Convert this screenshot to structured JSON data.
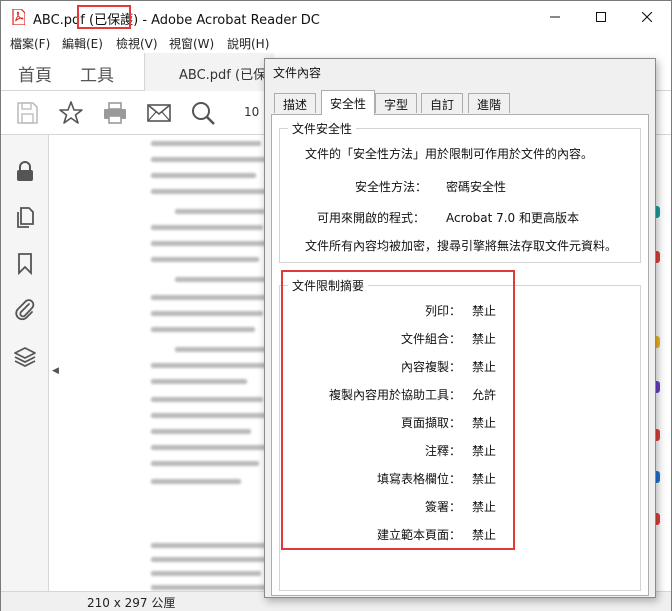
{
  "window": {
    "title_prefix": "ABC.pdf",
    "title_protected": "(已保護)",
    "title_suffix": "- Adobe Acrobat Reader DC"
  },
  "menu": [
    {
      "label": "檔案(F)"
    },
    {
      "label": "編輯(E)"
    },
    {
      "label": "檢視(V)"
    },
    {
      "label": "視窗(W)"
    },
    {
      "label": "說明(H)"
    }
  ],
  "tabs": {
    "home": "首頁",
    "tools": "工具",
    "document": "ABC.pdf (已保"
  },
  "toolbar": {
    "page_number": "10"
  },
  "status": {
    "page_size": "210 x 297 公厘"
  },
  "dialog": {
    "title": "文件內容",
    "tabs": [
      "描述",
      "安全性",
      "字型",
      "自訂",
      "進階"
    ],
    "active_tab": "安全性",
    "security": {
      "group_title": "文件安全性",
      "description": "文件的「安全性方法」用於限制可作用於文件的內容。",
      "method_label": "安全性方法：",
      "method_value": "密碼安全性",
      "opener_label": "可用來開啟的程式：",
      "opener_value": "Acrobat 7.0 和更高版本",
      "encryption_note": "文件所有內容均被加密，搜尋引擎將無法存取文件元資料。"
    },
    "restrictions": {
      "group_title": "文件限制摘要",
      "items": [
        {
          "label": "列印：",
          "value": "禁止"
        },
        {
          "label": "文件組合：",
          "value": "禁止"
        },
        {
          "label": "內容複製：",
          "value": "禁止"
        },
        {
          "label": "複製內容用於協助工具：",
          "value": "允許"
        },
        {
          "label": "頁面擷取：",
          "value": "禁止"
        },
        {
          "label": "注釋：",
          "value": "禁止"
        },
        {
          "label": "填寫表格欄位：",
          "value": "禁止"
        },
        {
          "label": "簽署：",
          "value": "禁止"
        },
        {
          "label": "建立範本頁面：",
          "value": "禁止"
        }
      ]
    }
  },
  "colors": {
    "highlight": "#e03a3a",
    "pdf_red": "#d9261c"
  }
}
